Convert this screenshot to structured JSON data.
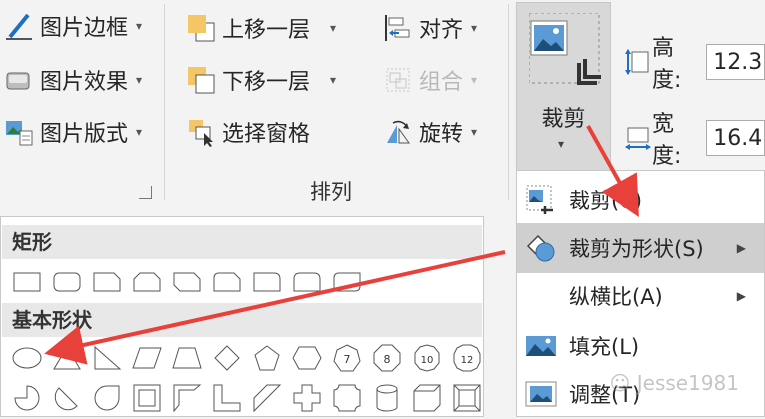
{
  "ribbon": {
    "picture_border": "图片边框",
    "picture_effects": "图片效果",
    "picture_layout": "图片版式",
    "bring_forward": "上移一层",
    "send_backward": "下移一层",
    "selection_pane": "选择窗格",
    "align": "对齐",
    "group": "组合",
    "rotate": "旋转",
    "arrange_group": "排列",
    "crop": "裁剪",
    "height_label": "高度:",
    "height_value": "12.3",
    "width_label": "宽度:",
    "width_value": "16.4"
  },
  "shapes_panel": {
    "rect_category": "矩形",
    "basic_category": "基本形状",
    "octagon_labels": [
      "7",
      "8",
      "10",
      "12"
    ]
  },
  "crop_menu": {
    "items": [
      {
        "label": "裁剪(C)",
        "has_submenu": false
      },
      {
        "label": "裁剪为形状(S)",
        "has_submenu": true,
        "highlighted": true
      },
      {
        "label": "纵横比(A)",
        "has_submenu": true
      },
      {
        "label": "填充(L)",
        "has_submenu": false
      },
      {
        "label": "调整(T)",
        "has_submenu": false
      }
    ]
  },
  "watermark": "Jesse1981",
  "colors": {
    "accent": "#1e6fc0",
    "arrow": "#e8403b",
    "shape_fill_yellow": "#f5c764"
  }
}
